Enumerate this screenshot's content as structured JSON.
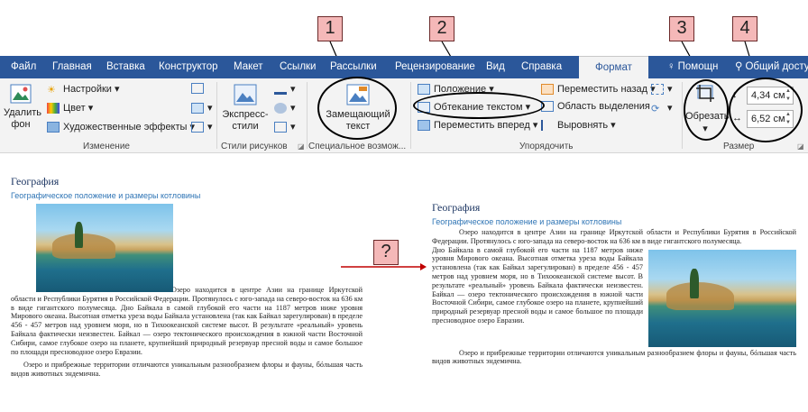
{
  "tabs": [
    {
      "label": "Файл",
      "active": false
    },
    {
      "label": "Главная",
      "active": false
    },
    {
      "label": "Вставка",
      "active": false
    },
    {
      "label": "Конструктор",
      "active": false
    },
    {
      "label": "Макет",
      "active": false
    },
    {
      "label": "Ссылки",
      "active": false
    },
    {
      "label": "Рассылки",
      "active": false
    },
    {
      "label": "Рецензирование",
      "active": false
    },
    {
      "label": "Вид",
      "active": false
    },
    {
      "label": "Справка",
      "active": false
    },
    {
      "label": "Формат",
      "active": true
    },
    {
      "label": "Помощн",
      "active": false
    },
    {
      "label": "Общий досту",
      "active": false
    }
  ],
  "ribbon": {
    "remove_bg": "Удалить\nфон",
    "settings": "Настройки",
    "color": "Цвет",
    "artistic": "Художественные эффекты",
    "group_change": "Изменение",
    "express_styles": "Экспресс-\nстили",
    "group_picture_styles": "Стили рисунков",
    "alt_text": "Замещающий\nтекст",
    "group_special": "Специальное возмож...",
    "position": "Положение",
    "wrap_text": "Обтекание текстом",
    "bring_forward": "Переместить вперед",
    "send_backward": "Переместить назад",
    "selection_pane": "Область выделения",
    "align": "Выровнять",
    "group_arrange": "Упорядочить",
    "crop": "Обрезать",
    "height": "4,34 см",
    "width": "6,52 см",
    "group_size": "Размер"
  },
  "callouts": [
    "1",
    "2",
    "3",
    "4",
    "?"
  ],
  "document": {
    "title": "География",
    "subtitle": "Географическое положение и размеры котловины",
    "left_para1": "Озеро находится в центре Азии на границе Иркутской области и Республики Бурятия в Российской Федерации. Протянулось с юго-запада на северо-восток на 636 км в виде гигантского полумесяца. Дно Байкала в самой глубокой его части на 1187 метров ниже уровня Мирового океана. Высотная отметка уреза воды Байкала установлена (так как Байкал зарегулирован) в пределе 456 - 457 метров над уровнем моря, но в Тихоокеанской системе высот. В результате «реальный» уровень Байкала фактически неизвестен. Байкал — озеро тектонического происхождения в южной части Восточной Сибири, самое глубокое озеро на планете, крупнейший природный резервуар пресной воды и самое большое по площади пресноводное озеро Евразии.",
    "right_para1_top": "Озеро находится в центре Азии на границе Иркутской области и Республики Бурятия в Российской Федерации. Протянулось с юго-запада на северо-восток на 636 км в виде гигантского полумесяца.",
    "right_para1_wrap": "Дно Байкала в самой глубокой его части на 1187 метров ниже уровня Мирового океана. Высотная отметка уреза воды Байкала установлена (так как Байкал зарегулирован) в пределе 456 - 457 метров над уровнем моря, но в Тихоокеанской системе высот. В результате «реальный» уровень Байкала фактически неизвестен. Байкал — озеро тектонического происхождения в южной части Восточной Сибири, самое глубокое озеро на планете, крупнейший природный резервуар пресной воды и самое большое по площади пресноводное озеро Евразии.",
    "para2": "Озеро и прибрежные территории отличаются уникальным разнообразием флоры и фауны, бóльшая часть видов животных эндемична."
  }
}
